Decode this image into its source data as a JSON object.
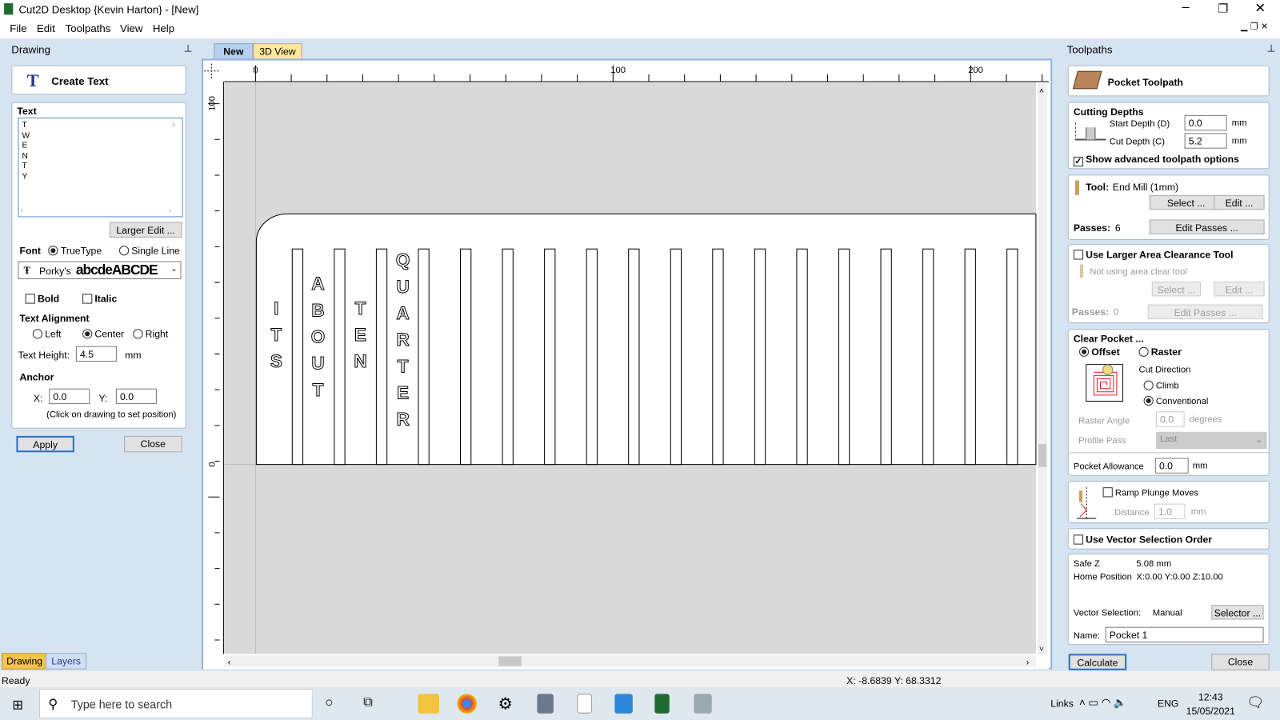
{
  "window": {
    "title": "Cut2D Desktop {Kevin Harton} - [New]"
  },
  "menu": [
    "File",
    "Edit",
    "Toolpaths",
    "View",
    "Help"
  ],
  "left_panel": {
    "title": "Drawing",
    "create_text": "Create Text",
    "text_label": "Text",
    "text_value": [
      "T",
      "W",
      "E",
      "N",
      "T",
      "Y"
    ],
    "larger_edit": "Larger Edit ...",
    "font_label": "Font",
    "truetype": "TrueType",
    "single_line": "Single Line",
    "font_name": "Porky's",
    "font_sample": "abcdeABCDE",
    "bold": "Bold",
    "italic": "Italic",
    "alignment_label": "Text Alignment",
    "left": "Left",
    "center": "Center",
    "right": "Right",
    "height_label": "Text Height:",
    "height_value": "4.5",
    "mm": "mm",
    "anchor_label": "Anchor",
    "x_label": "X:",
    "x_value": "0.0",
    "y_label": "Y:",
    "y_value": "0.0",
    "anchor_hint": "(Click on drawing to set position)",
    "apply": "Apply",
    "close": "Close",
    "tabs": [
      "Drawing",
      "Layers"
    ]
  },
  "view_tabs": [
    "New",
    "3D View"
  ],
  "ruler": {
    "x_labels": [
      "0",
      "100",
      "200"
    ],
    "y_labels": [
      "100",
      "0"
    ]
  },
  "drawing": {
    "words": [
      "ITS",
      "ABOUT",
      "TEN",
      "QUARTER"
    ]
  },
  "right_panel": {
    "title": "Toolpaths",
    "header": "Pocket Toolpath",
    "cutting_depths": "Cutting Depths",
    "start_depth_label": "Start Depth (D)",
    "start_depth": "0.0",
    "cut_depth_label": "Cut Depth (C)",
    "cut_depth": "5.2",
    "mm": "mm",
    "show_advanced": "Show advanced toolpath options",
    "tool_label": "Tool:",
    "tool_name": "End Mill (1mm)",
    "select": "Select ...",
    "edit": "Edit ...",
    "passes_label": "Passes:",
    "passes": "6",
    "edit_passes": "Edit Passes ...",
    "larger_area": "Use Larger Area Clearance Tool",
    "not_using": "Not using area clear tool",
    "passes2": "0",
    "clear_pocket": "Clear Pocket ...",
    "offset": "Offset",
    "raster": "Raster",
    "cut_direction": "Cut Direction",
    "climb": "Climb",
    "conventional": "Conventional",
    "raster_angle_label": "Raster Angle",
    "raster_angle": "0.0",
    "degrees": "degrees",
    "profile_pass_label": "Profile Pass",
    "profile_pass": "Last",
    "pocket_allowance_label": "Pocket Allowance",
    "pocket_allowance": "0.0",
    "ramp": "Ramp Plunge Moves",
    "distance_label": "Distance",
    "distance": "1.0",
    "vector_order": "Use Vector Selection Order",
    "safe_z_label": "Safe Z",
    "safe_z": "5.08 mm",
    "home_label": "Home Position",
    "home": "X:0.00 Y:0.00 Z:10.00",
    "vector_sel_label": "Vector Selection:",
    "vector_sel": "Manual",
    "selector": "Selector ...",
    "name_label": "Name:",
    "name": "Pocket 1",
    "calculate": "Calculate",
    "close": "Close"
  },
  "status": {
    "left": "Ready",
    "coords": "X: -8.6839 Y: 68.3312"
  },
  "taskbar": {
    "search": "Type here to search",
    "links": "Links",
    "lang": "ENG",
    "time": "12:43",
    "date": "15/05/2021"
  }
}
